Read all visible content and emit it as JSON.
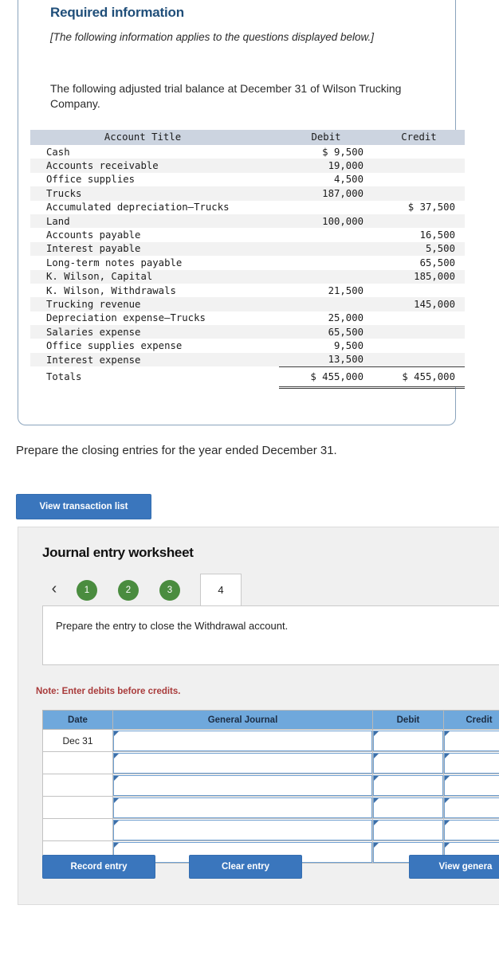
{
  "required_info": {
    "title": "Required information",
    "italic_note": "[The following information applies to the questions displayed below.]",
    "body": "The following adjusted trial balance at December 31 of Wilson Trucking Company."
  },
  "trial_balance": {
    "headers": [
      "Account Title",
      "Debit",
      "Credit"
    ],
    "rows": [
      {
        "account": "Cash",
        "debit": "$ 9,500",
        "credit": ""
      },
      {
        "account": "Accounts receivable",
        "debit": "19,000",
        "credit": ""
      },
      {
        "account": "Office supplies",
        "debit": "4,500",
        "credit": ""
      },
      {
        "account": "Trucks",
        "debit": "187,000",
        "credit": ""
      },
      {
        "account": "Accumulated depreciation—Trucks",
        "debit": "",
        "credit": "$ 37,500"
      },
      {
        "account": "Land",
        "debit": "100,000",
        "credit": ""
      },
      {
        "account": "Accounts payable",
        "debit": "",
        "credit": "16,500"
      },
      {
        "account": "Interest payable",
        "debit": "",
        "credit": "5,500"
      },
      {
        "account": "Long-term notes payable",
        "debit": "",
        "credit": "65,500"
      },
      {
        "account": "K. Wilson, Capital",
        "debit": "",
        "credit": "185,000"
      },
      {
        "account": "K. Wilson, Withdrawals",
        "debit": "21,500",
        "credit": ""
      },
      {
        "account": "Trucking revenue",
        "debit": "",
        "credit": "145,000"
      },
      {
        "account": "Depreciation expense—Trucks",
        "debit": "25,000",
        "credit": ""
      },
      {
        "account": "Salaries expense",
        "debit": "65,500",
        "credit": ""
      },
      {
        "account": "Office supplies expense",
        "debit": "9,500",
        "credit": ""
      },
      {
        "account": "Interest expense",
        "debit": "13,500",
        "credit": ""
      }
    ],
    "totals": {
      "account": "Totals",
      "debit": "$ 455,000",
      "credit": "$ 455,000"
    }
  },
  "prompt": "Prepare the closing entries for the year ended December 31.",
  "view_transaction_list_label": "View transaction list",
  "worksheet": {
    "title": "Journal entry worksheet",
    "prev_icon": "‹",
    "tabs": [
      {
        "label": "1",
        "state": "complete"
      },
      {
        "label": "2",
        "state": "complete"
      },
      {
        "label": "3",
        "state": "complete"
      },
      {
        "label": "4",
        "state": "active"
      }
    ],
    "instruction": "Prepare the entry to close the Withdrawal account.",
    "note": "Note: Enter debits before credits.",
    "journal": {
      "headers": [
        "Date",
        "General Journal",
        "Debit",
        "Credit"
      ],
      "rows": [
        {
          "date": "Dec 31",
          "general_journal": "",
          "debit": "",
          "credit": ""
        },
        {
          "date": "",
          "general_journal": "",
          "debit": "",
          "credit": ""
        },
        {
          "date": "",
          "general_journal": "",
          "debit": "",
          "credit": ""
        },
        {
          "date": "",
          "general_journal": "",
          "debit": "",
          "credit": ""
        },
        {
          "date": "",
          "general_journal": "",
          "debit": "",
          "credit": ""
        },
        {
          "date": "",
          "general_journal": "",
          "debit": "",
          "credit": ""
        }
      ]
    },
    "buttons": {
      "record": "Record entry",
      "clear": "Clear entry",
      "view_general_journal": "View genera"
    }
  },
  "colors": {
    "brand_blue": "#3a76bd",
    "tab_complete_green": "#4a8c3f",
    "table_header_blue": "#6fa8dc",
    "trial_balance_header": "#ccd4e0",
    "note_red": "#a93b3b",
    "heading_navy": "#1f4e79"
  }
}
